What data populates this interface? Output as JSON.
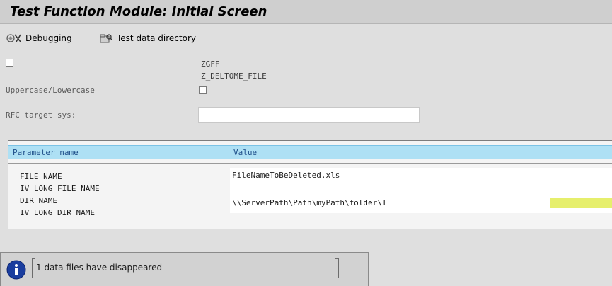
{
  "window": {
    "title": "Test Function Module: Initial Screen"
  },
  "toolbar": {
    "debugging_label": "Debugging",
    "test_data_dir_label": "Test data directory"
  },
  "header_fields": {
    "row1_value": "ZGFF",
    "row2_value": "Z_DELTOME_FILE",
    "uppercase_label": "Uppercase/Lowercase",
    "rfc_target_label": "RFC target sys:",
    "rfc_target_value": ""
  },
  "param_table": {
    "col_parameter": "Parameter name",
    "col_value": "Value",
    "rows": [
      {
        "name": "FILE_NAME",
        "value": "FileNameToBeDeleted.xls"
      },
      {
        "name": "IV_LONG_FILE_NAME",
        "value": ""
      },
      {
        "name": "DIR_NAME",
        "value": "\\\\ServerPath\\Path\\myPath\\folder\\T"
      },
      {
        "name": "IV_LONG_DIR_NAME",
        "value": ""
      }
    ]
  },
  "status": {
    "message": "1 data files have disappeared"
  },
  "colors": {
    "title_bar": "#cfcfcf",
    "background": "#dfdfdf",
    "header_blue": "#aee0f4",
    "highlight": "#e6ef6c",
    "info_icon": "#1a3d9e"
  },
  "icons": {
    "debugging": "debug-icon",
    "test_data_directory": "folder-test-icon",
    "status": "info-icon"
  }
}
